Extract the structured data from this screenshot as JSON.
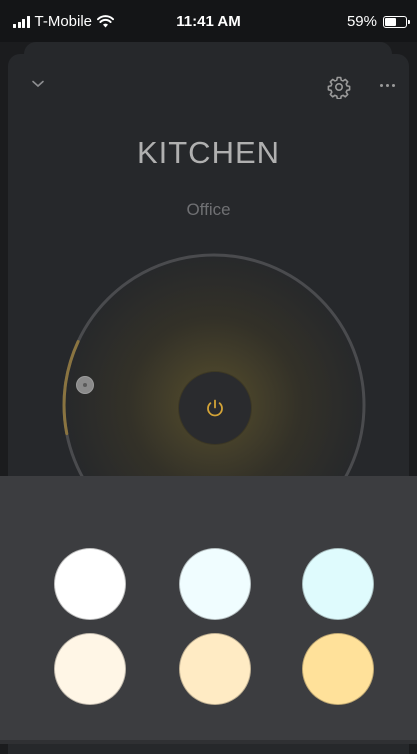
{
  "status_bar": {
    "carrier": "T-Mobile",
    "time": "11:41 AM",
    "battery_percent": "59%",
    "battery_level": 0.59
  },
  "header": {
    "room": "KITCHEN",
    "group": "Office"
  },
  "dial": {
    "brightness_fraction": 0.2,
    "accent_color": "#8a7440",
    "power_icon_color": "#d4a437"
  },
  "color_tray": {
    "swatches": [
      {
        "color": "#ffffff"
      },
      {
        "color": "#f0fdff"
      },
      {
        "color": "#dffbfd"
      },
      {
        "color": "#fff6e6"
      },
      {
        "color": "#ffebc4"
      },
      {
        "color": "#ffe19a"
      }
    ]
  }
}
